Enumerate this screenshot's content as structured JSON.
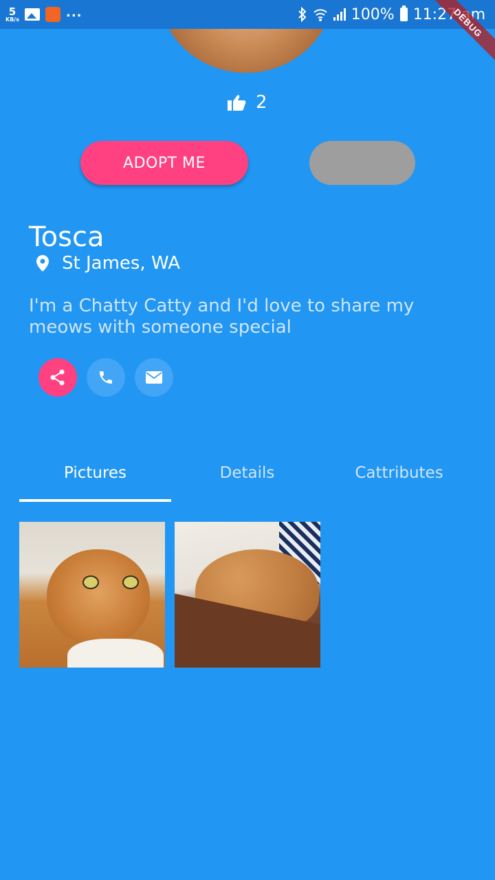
{
  "status_bar": {
    "speed_value": "5",
    "speed_unit": "KB/s",
    "overflow": "...",
    "battery": "100%",
    "time": "11:27 am"
  },
  "debug_banner": "DEBUG",
  "likes": {
    "count": "2"
  },
  "actions": {
    "adopt_label": "ADOPT ME"
  },
  "profile": {
    "name": "Tosca",
    "location": "St James, WA",
    "bio": "I'm a Chatty Catty and I'd love to share my meows with someone special"
  },
  "tabs": [
    {
      "label": "Pictures",
      "active": true
    },
    {
      "label": "Details",
      "active": false
    },
    {
      "label": "Cattributes",
      "active": false
    }
  ],
  "colors": {
    "background": "#2196F3",
    "accent": "#FF4081",
    "disabled_button": "#9E9E9E"
  },
  "icons": {
    "like": "thumb-up-icon",
    "location": "location-pin-icon",
    "share": "share-icon",
    "phone": "phone-icon",
    "email": "email-icon"
  }
}
